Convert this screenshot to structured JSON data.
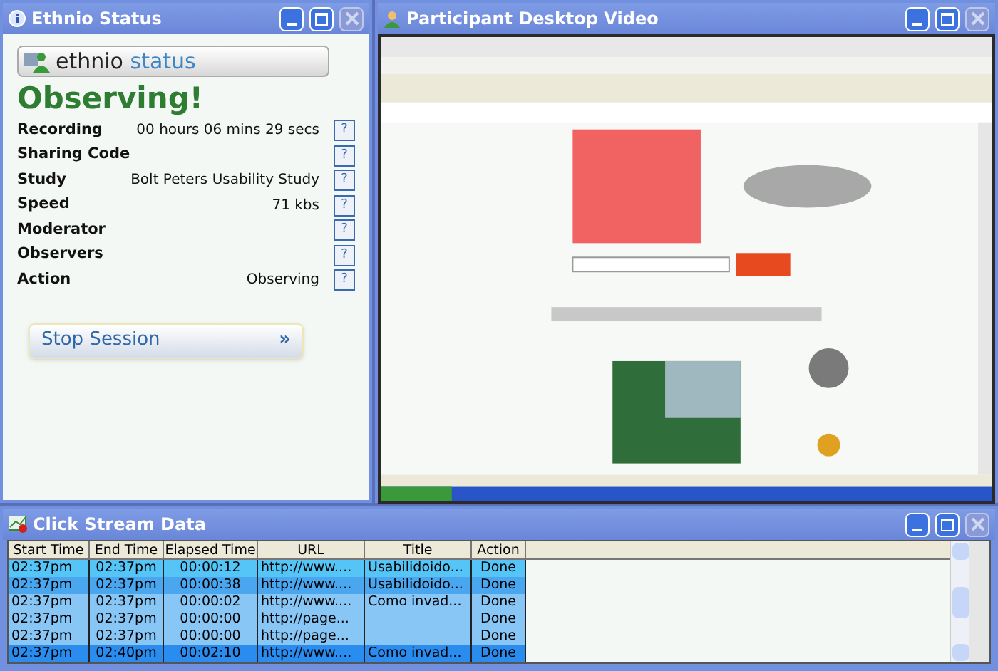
{
  "status_window": {
    "title": "Ethnio Status",
    "logo_word_1": "ethnio",
    "logo_word_2": "status",
    "headline": "Observing!",
    "fields": [
      {
        "label": "Recording",
        "value": "00 hours 06 mins 29 secs",
        "help": "?"
      },
      {
        "label": "Sharing Code",
        "help": "?"
      },
      {
        "label": "Study",
        "value": "Bolt Peters Usability Study",
        "help": "?"
      },
      {
        "label": "Speed",
        "value": "71 kbs",
        "help": "?"
      },
      {
        "label": "Moderator",
        "help": "?"
      },
      {
        "label": "Observers",
        "help": "?"
      },
      {
        "label": "Action",
        "value": "Observing",
        "help": "?"
      }
    ],
    "stop_button": "Stop Session",
    "stop_arrow": "»"
  },
  "video_window": {
    "title": "Participant Desktop Video"
  },
  "clickstream_window": {
    "title": "Click Stream Data",
    "columns": [
      "Start Time",
      "End Time",
      "Elapsed Time",
      "URL",
      "Title",
      "Action"
    ],
    "rows": [
      {
        "cells": [
          "02:37pm",
          "02:37pm",
          "00:00:12",
          "http://www....",
          "Usabilidoido...",
          "Done"
        ],
        "color": "#55c4f6"
      },
      {
        "cells": [
          "02:37pm",
          "02:37pm",
          "00:00:38",
          "http://www....",
          "Usabilidoido...",
          "Done"
        ],
        "color": "#4aa6ee"
      },
      {
        "cells": [
          "02:37pm",
          "02:37pm",
          "00:00:02",
          "http://www....",
          "Como invad...",
          "Done"
        ],
        "color": "#88c6f6"
      },
      {
        "cells": [
          "02:37pm",
          "02:37pm",
          "00:00:00",
          "http://page...",
          "",
          "Done"
        ],
        "color": "#88c6f6"
      },
      {
        "cells": [
          "02:37pm",
          "02:37pm",
          "00:00:00",
          "http://page...",
          "",
          "Done"
        ],
        "color": "#88c6f6"
      },
      {
        "cells": [
          "02:37pm",
          "02:40pm",
          "00:02:10",
          "http://www....",
          "Como invad...",
          "Done"
        ],
        "color": "#2b8cef"
      }
    ]
  }
}
